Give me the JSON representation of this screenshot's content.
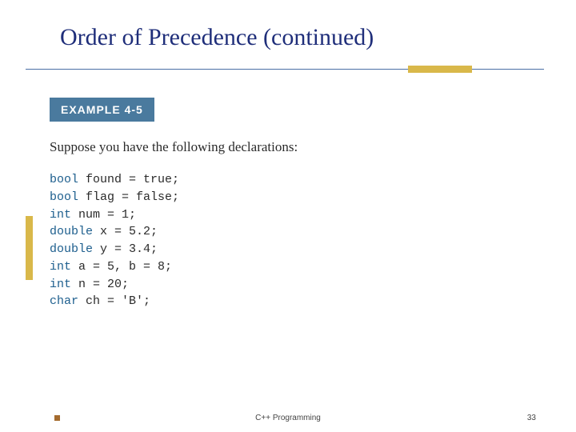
{
  "title": "Order of Precedence (continued)",
  "example_badge": "EXAMPLE 4-5",
  "intro": "Suppose you have the following declarations:",
  "code": [
    {
      "kw": "bool",
      "rest": " found = true;"
    },
    {
      "kw": "bool",
      "rest": " flag = false;"
    },
    {
      "kw": "int",
      "rest": " num = 1;"
    },
    {
      "kw": "double",
      "rest": " x = 5.2;"
    },
    {
      "kw": "double",
      "rest": " y = 3.4;"
    },
    {
      "kw": "int",
      "rest": " a = 5, b = 8;"
    },
    {
      "kw": "int",
      "rest": " n = 20;"
    },
    {
      "kw": "char",
      "rest": " ch = 'B';"
    }
  ],
  "footer": {
    "label": "C++ Programming",
    "page": "33"
  },
  "colors": {
    "title_color": "#1f2e7a",
    "accent": "#d9b84a",
    "divider": "#4a6fa5",
    "badge_bg": "#4a7a9e",
    "keyword": "#1e5f8e"
  }
}
